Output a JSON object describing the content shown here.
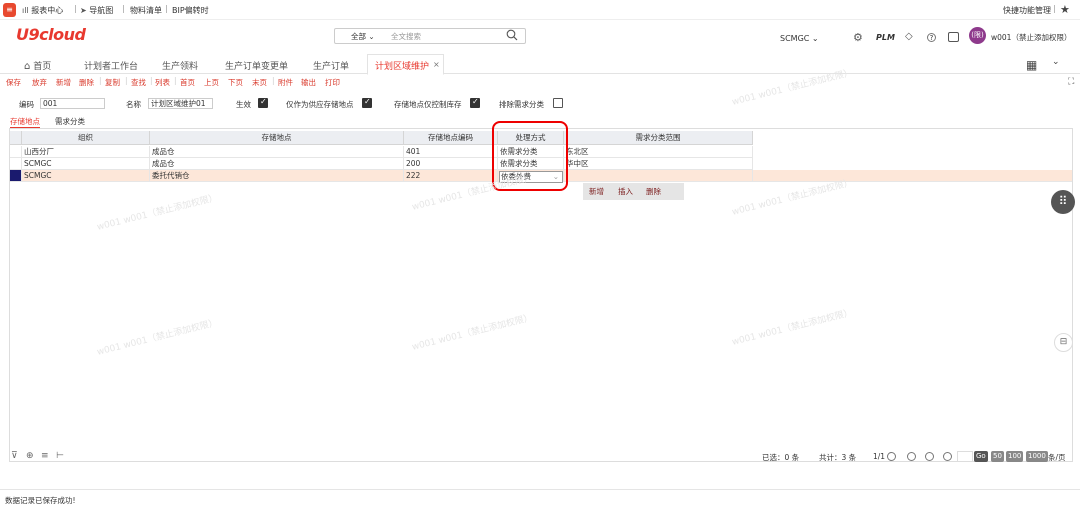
{
  "topbar": {
    "links": [
      "报表中心",
      "导航图",
      "物料清单",
      "BIP偏转时"
    ],
    "quick": "快捷功能管理"
  },
  "header": {
    "logo": "U9cloud",
    "search_scope": "全部",
    "search_placeholder": "全文搜索",
    "org": "SCMGC",
    "plm": "PLM",
    "avatar_text": "(限)",
    "user": "w001（禁止添加权限）"
  },
  "tabs": [
    {
      "label": "首页"
    },
    {
      "label": "计划者工作台"
    },
    {
      "label": "生产领料"
    },
    {
      "label": "生产订单变更单"
    },
    {
      "label": "生产订单"
    },
    {
      "label": "计划区域维护",
      "active": true
    }
  ],
  "toolbar": [
    "保存",
    "放弃",
    "新增",
    "删除",
    "复制",
    "查找",
    "列表",
    "首页",
    "上页",
    "下页",
    "末页",
    "附件",
    "输出",
    "打印"
  ],
  "form": {
    "code_label": "编码",
    "code_value": "001",
    "name_label": "名称",
    "name_value": "计划区域维护01",
    "effective_label": "生效",
    "supply_only_label": "仅作为供应存储地点",
    "inventory_only_label": "存储地点仅控制库存",
    "exclude_label": "排除需求分类"
  },
  "subtabs": [
    "存储地点",
    "需求分类"
  ],
  "grid": {
    "columns": [
      "组织",
      "存储地点",
      "存储地点编码",
      "处理方式",
      "需求分类范围"
    ],
    "rows": [
      [
        "山西分厂",
        "成品仓",
        "401",
        "依需求分类",
        "东北区"
      ],
      [
        "SCMGC",
        "成品仓",
        "200",
        "依需求分类",
        "华中区"
      ],
      [
        "SCMGC",
        "委托代销仓",
        "222",
        "依委外费",
        ""
      ]
    ],
    "row_actions": [
      "新增",
      "插入",
      "删除"
    ]
  },
  "pager": {
    "selected": "已选：0 条",
    "total": "共计：3 条",
    "page": "1/1",
    "go": "Go",
    "sizes": [
      "50",
      "100",
      "1000"
    ],
    "per_page": "条/页"
  },
  "status": "数据记录已保存成功!",
  "watermark": "w001 w001（禁止添加权限）",
  "colors": {
    "accent": "#e8392f",
    "selected_row": "#fde7d9",
    "highlight": "#e00000"
  }
}
